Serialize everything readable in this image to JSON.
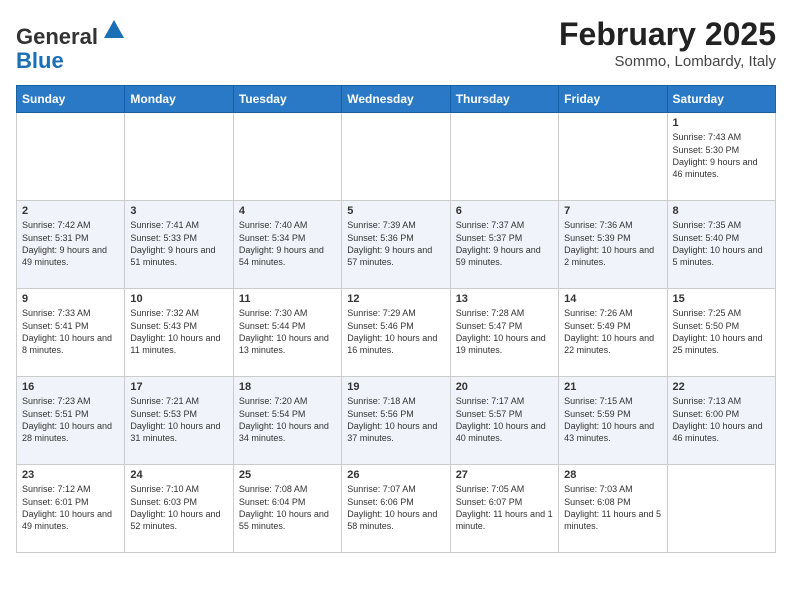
{
  "header": {
    "logo_line1": "General",
    "logo_line2": "Blue",
    "month_title": "February 2025",
    "location": "Sommo, Lombardy, Italy"
  },
  "weekdays": [
    "Sunday",
    "Monday",
    "Tuesday",
    "Wednesday",
    "Thursday",
    "Friday",
    "Saturday"
  ],
  "weeks": [
    [
      {
        "day": "",
        "info": ""
      },
      {
        "day": "",
        "info": ""
      },
      {
        "day": "",
        "info": ""
      },
      {
        "day": "",
        "info": ""
      },
      {
        "day": "",
        "info": ""
      },
      {
        "day": "",
        "info": ""
      },
      {
        "day": "1",
        "info": "Sunrise: 7:43 AM\nSunset: 5:30 PM\nDaylight: 9 hours and 46 minutes."
      }
    ],
    [
      {
        "day": "2",
        "info": "Sunrise: 7:42 AM\nSunset: 5:31 PM\nDaylight: 9 hours and 49 minutes."
      },
      {
        "day": "3",
        "info": "Sunrise: 7:41 AM\nSunset: 5:33 PM\nDaylight: 9 hours and 51 minutes."
      },
      {
        "day": "4",
        "info": "Sunrise: 7:40 AM\nSunset: 5:34 PM\nDaylight: 9 hours and 54 minutes."
      },
      {
        "day": "5",
        "info": "Sunrise: 7:39 AM\nSunset: 5:36 PM\nDaylight: 9 hours and 57 minutes."
      },
      {
        "day": "6",
        "info": "Sunrise: 7:37 AM\nSunset: 5:37 PM\nDaylight: 9 hours and 59 minutes."
      },
      {
        "day": "7",
        "info": "Sunrise: 7:36 AM\nSunset: 5:39 PM\nDaylight: 10 hours and 2 minutes."
      },
      {
        "day": "8",
        "info": "Sunrise: 7:35 AM\nSunset: 5:40 PM\nDaylight: 10 hours and 5 minutes."
      }
    ],
    [
      {
        "day": "9",
        "info": "Sunrise: 7:33 AM\nSunset: 5:41 PM\nDaylight: 10 hours and 8 minutes."
      },
      {
        "day": "10",
        "info": "Sunrise: 7:32 AM\nSunset: 5:43 PM\nDaylight: 10 hours and 11 minutes."
      },
      {
        "day": "11",
        "info": "Sunrise: 7:30 AM\nSunset: 5:44 PM\nDaylight: 10 hours and 13 minutes."
      },
      {
        "day": "12",
        "info": "Sunrise: 7:29 AM\nSunset: 5:46 PM\nDaylight: 10 hours and 16 minutes."
      },
      {
        "day": "13",
        "info": "Sunrise: 7:28 AM\nSunset: 5:47 PM\nDaylight: 10 hours and 19 minutes."
      },
      {
        "day": "14",
        "info": "Sunrise: 7:26 AM\nSunset: 5:49 PM\nDaylight: 10 hours and 22 minutes."
      },
      {
        "day": "15",
        "info": "Sunrise: 7:25 AM\nSunset: 5:50 PM\nDaylight: 10 hours and 25 minutes."
      }
    ],
    [
      {
        "day": "16",
        "info": "Sunrise: 7:23 AM\nSunset: 5:51 PM\nDaylight: 10 hours and 28 minutes."
      },
      {
        "day": "17",
        "info": "Sunrise: 7:21 AM\nSunset: 5:53 PM\nDaylight: 10 hours and 31 minutes."
      },
      {
        "day": "18",
        "info": "Sunrise: 7:20 AM\nSunset: 5:54 PM\nDaylight: 10 hours and 34 minutes."
      },
      {
        "day": "19",
        "info": "Sunrise: 7:18 AM\nSunset: 5:56 PM\nDaylight: 10 hours and 37 minutes."
      },
      {
        "day": "20",
        "info": "Sunrise: 7:17 AM\nSunset: 5:57 PM\nDaylight: 10 hours and 40 minutes."
      },
      {
        "day": "21",
        "info": "Sunrise: 7:15 AM\nSunset: 5:59 PM\nDaylight: 10 hours and 43 minutes."
      },
      {
        "day": "22",
        "info": "Sunrise: 7:13 AM\nSunset: 6:00 PM\nDaylight: 10 hours and 46 minutes."
      }
    ],
    [
      {
        "day": "23",
        "info": "Sunrise: 7:12 AM\nSunset: 6:01 PM\nDaylight: 10 hours and 49 minutes."
      },
      {
        "day": "24",
        "info": "Sunrise: 7:10 AM\nSunset: 6:03 PM\nDaylight: 10 hours and 52 minutes."
      },
      {
        "day": "25",
        "info": "Sunrise: 7:08 AM\nSunset: 6:04 PM\nDaylight: 10 hours and 55 minutes."
      },
      {
        "day": "26",
        "info": "Sunrise: 7:07 AM\nSunset: 6:06 PM\nDaylight: 10 hours and 58 minutes."
      },
      {
        "day": "27",
        "info": "Sunrise: 7:05 AM\nSunset: 6:07 PM\nDaylight: 11 hours and 1 minute."
      },
      {
        "day": "28",
        "info": "Sunrise: 7:03 AM\nSunset: 6:08 PM\nDaylight: 11 hours and 5 minutes."
      },
      {
        "day": "",
        "info": ""
      }
    ]
  ]
}
